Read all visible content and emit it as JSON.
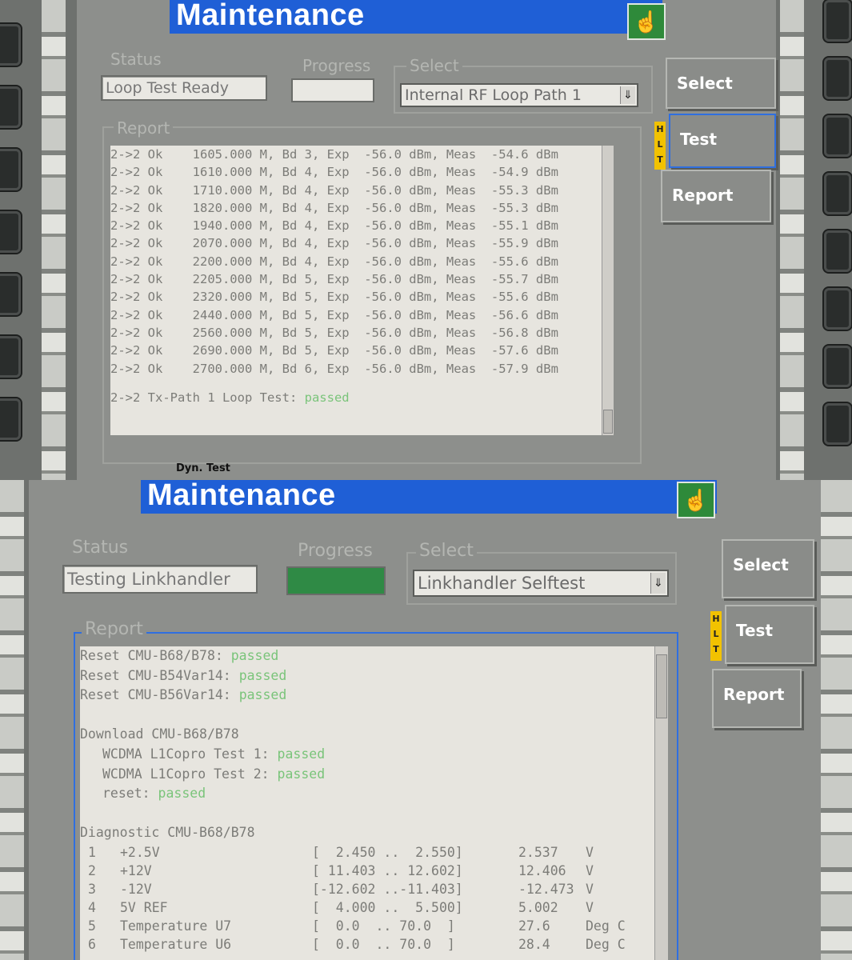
{
  "top": {
    "title": "Maintenance",
    "status_label": "Status",
    "status_value": "Loop Test Ready",
    "progress_label": "Progress",
    "select_label": "Select",
    "select_value": "Internal RF Loop Path 1",
    "report_label": "Report",
    "report_rows": [
      "2->2 Ok    1605.000 M, Bd 3, Exp  -56.0 dBm, Meas  -54.6 dBm",
      "2->2 Ok    1610.000 M, Bd 4, Exp  -56.0 dBm, Meas  -54.9 dBm",
      "2->2 Ok    1710.000 M, Bd 4, Exp  -56.0 dBm, Meas  -55.3 dBm",
      "2->2 Ok    1820.000 M, Bd 4, Exp  -56.0 dBm, Meas  -55.3 dBm",
      "2->2 Ok    1940.000 M, Bd 4, Exp  -56.0 dBm, Meas  -55.1 dBm",
      "2->2 Ok    2070.000 M, Bd 4, Exp  -56.0 dBm, Meas  -55.9 dBm",
      "2->2 Ok    2200.000 M, Bd 4, Exp  -56.0 dBm, Meas  -55.6 dBm",
      "2->2 Ok    2205.000 M, Bd 5, Exp  -56.0 dBm, Meas  -55.7 dBm",
      "2->2 Ok    2320.000 M, Bd 5, Exp  -56.0 dBm, Meas  -55.6 dBm",
      "2->2 Ok    2440.000 M, Bd 5, Exp  -56.0 dBm, Meas  -56.6 dBm",
      "2->2 Ok    2560.000 M, Bd 5, Exp  -56.0 dBm, Meas  -56.8 dBm",
      "2->2 Ok    2690.000 M, Bd 5, Exp  -56.0 dBm, Meas  -57.6 dBm",
      "2->2 Ok    2700.000 M, Bd 6, Exp  -56.0 dBm, Meas  -57.9 dBm"
    ],
    "summary_prefix": "2->2 Tx-Path 1 Loop Test: ",
    "summary_result": "passed",
    "tab_label": "Dyn. Test",
    "softkeys": {
      "select": "Select",
      "test": "Test",
      "report": "Report"
    },
    "hlt_badge": "HLT"
  },
  "bottom": {
    "title": "Maintenance",
    "status_label": "Status",
    "status_value": "Testing Linkhandler",
    "progress_label": "Progress",
    "progress_fraction": 1.0,
    "select_label": "Select",
    "select_value": "Linkhandler Selftest",
    "report_label": "Report",
    "lines": [
      {
        "text": "Reset CMU-B68/B78: ",
        "result": "passed",
        "indent": 0
      },
      {
        "text": "Reset CMU-B54Var14: ",
        "result": "passed",
        "indent": 0
      },
      {
        "text": "Reset CMU-B56Var14: ",
        "result": "passed",
        "indent": 0
      },
      {
        "text": "",
        "result": "",
        "indent": 0
      },
      {
        "text": "Download CMU-B68/B78",
        "result": "",
        "indent": 0
      },
      {
        "text": "WCDMA L1Copro Test 1: ",
        "result": "passed",
        "indent": 2
      },
      {
        "text": "WCDMA L1Copro Test 2: ",
        "result": "passed",
        "indent": 2
      },
      {
        "text": "reset: ",
        "result": "passed",
        "indent": 2
      },
      {
        "text": "",
        "result": "",
        "indent": 0
      },
      {
        "text": "Diagnostic CMU-B68/B78",
        "result": "",
        "indent": 0
      }
    ],
    "diagnostics": [
      {
        "num": "1",
        "name": "+2.5V",
        "range": "[  2.450 ..  2.550]",
        "value": "2.537",
        "unit": "V"
      },
      {
        "num": "2",
        "name": "+12V",
        "range": "[ 11.403 .. 12.602]",
        "value": "12.406",
        "unit": "V"
      },
      {
        "num": "3",
        "name": "-12V",
        "range": "[-12.602 ..-11.403]",
        "value": "-12.473",
        "unit": "V"
      },
      {
        "num": "4",
        "name": "5V REF",
        "range": "[  4.000 ..  5.500]",
        "value": "5.002",
        "unit": "V"
      },
      {
        "num": "5",
        "name": "Temperature U7",
        "range": "[  0.0  .. 70.0  ]",
        "value": "27.6",
        "unit": "Deg C"
      },
      {
        "num": "6",
        "name": "Temperature U6",
        "range": "[  0.0  .. 70.0  ]",
        "value": "28.4",
        "unit": "Deg C"
      }
    ],
    "softkeys": {
      "select": "Select",
      "test": "Test",
      "report": "Report"
    },
    "hlt_badge": "HLT"
  },
  "colors": {
    "title_blue": "#1f5fd6",
    "passed_green": "#7ac47a",
    "hlt_yellow": "#f2c200",
    "progress_green": "#2f8a45"
  },
  "icons": {
    "mode_icon": "pointing-hand-icon"
  }
}
